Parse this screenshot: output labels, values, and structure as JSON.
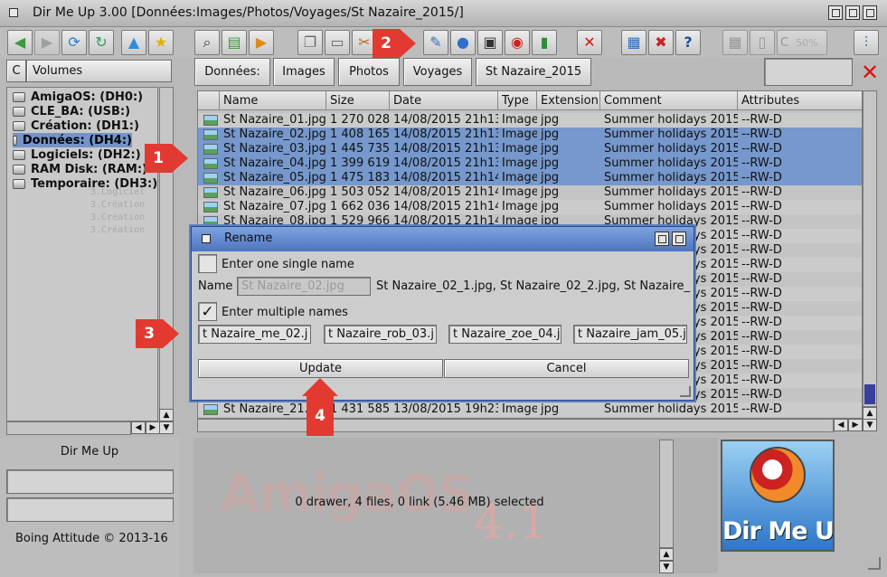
{
  "window": {
    "title": "Dir Me Up 3.00 [Données:Images/Photos/Voyages/St Nazaire_2015/]"
  },
  "icons": {
    "toolbar_left": [
      "back-arrow-icon",
      "forward-arrow-icon",
      "reload-icon",
      "refresh-icon",
      "new-drawer-icon",
      "favorite-star-icon"
    ],
    "toolbar_mid": [
      "search-icon",
      "size-icon",
      "play-icon",
      "copy-icon",
      "paste-icon",
      "cut-icon",
      "rename-icon",
      "comment-icon",
      "protect-lock-icon",
      "info-icon",
      "book-icon"
    ],
    "toolbar_right": [
      "delete-icon",
      "sort-icon",
      "kill-icon",
      "help-icon"
    ]
  },
  "toolbar": {
    "percent": "50%"
  },
  "left_panel": {
    "header": "Volumes",
    "volumes": [
      {
        "label": "AmigaOS: (DH0:)",
        "selected": false
      },
      {
        "label": "CLE_BA: (USB:)",
        "selected": false
      },
      {
        "label": "Création: (DH1:)",
        "selected": false
      },
      {
        "label": "Données: (DH4:)",
        "selected": true
      },
      {
        "label": "Logiciels: (DH2:)",
        "selected": false
      },
      {
        "label": "RAM Disk: (RAM:)",
        "selected": false
      },
      {
        "label": "Temporaire: (DH3:)",
        "selected": false
      }
    ],
    "app_name": "Dir Me Up",
    "copyright": "Boing Attitude © 2013-16"
  },
  "breadcrumb": [
    "Données:",
    "Images",
    "Photos",
    "Voyages",
    "St Nazaire_2015"
  ],
  "table": {
    "columns": [
      "Name",
      "Size",
      "Date",
      "Type",
      "Extension",
      "Comment",
      "Attributes"
    ],
    "rows": [
      {
        "name": "St Nazaire_01.jpg",
        "size": "1 270 028",
        "date": "14/08/2015 21h13",
        "type": "Image",
        "ext": "jpg",
        "comment": "Summer holidays 2015",
        "attr": "--RW-D",
        "selected": false
      },
      {
        "name": "St Nazaire_02.jpg",
        "size": "1 408 165",
        "date": "14/08/2015 21h13",
        "type": "Image",
        "ext": "jpg",
        "comment": "Summer holidays 2015",
        "attr": "--RW-D",
        "selected": true
      },
      {
        "name": "St Nazaire_03.jpg",
        "size": "1 445 735",
        "date": "14/08/2015 21h13",
        "type": "Image",
        "ext": "jpg",
        "comment": "Summer holidays 2015",
        "attr": "--RW-D",
        "selected": true
      },
      {
        "name": "St Nazaire_04.jpg",
        "size": "1 399 619",
        "date": "14/08/2015 21h13",
        "type": "Image",
        "ext": "jpg",
        "comment": "Summer holidays 2015",
        "attr": "--RW-D",
        "selected": true
      },
      {
        "name": "St Nazaire_05.jpg",
        "size": "1 475 183",
        "date": "14/08/2015 21h14",
        "type": "Image",
        "ext": "jpg",
        "comment": "Summer holidays 2015",
        "attr": "--RW-D",
        "selected": true
      },
      {
        "name": "St Nazaire_06.jpg",
        "size": "1 503 052",
        "date": "14/08/2015 21h14",
        "type": "Image",
        "ext": "jpg",
        "comment": "Summer holidays 2015",
        "attr": "--RW-D",
        "selected": false
      },
      {
        "name": "St Nazaire_07.jpg",
        "size": "1 662 036",
        "date": "14/08/2015 21h14",
        "type": "Image",
        "ext": "jpg",
        "comment": "Summer holidays 2015",
        "attr": "--RW-D",
        "selected": false
      },
      {
        "name": "St Nazaire_08.jpg",
        "size": "1 529 966",
        "date": "14/08/2015 21h14",
        "type": "Image",
        "ext": "jpg",
        "comment": "Summer holidays 2015",
        "attr": "--RW-D",
        "selected": false
      },
      {
        "name": "",
        "size": "",
        "date": "",
        "type": "",
        "ext": "",
        "comment": "Summer holidays 2015",
        "attr": "--RW-D",
        "selected": false
      },
      {
        "name": "",
        "size": "",
        "date": "",
        "type": "",
        "ext": "",
        "comment": "Summer holidays 2015",
        "attr": "--RW-D",
        "selected": false
      },
      {
        "name": "",
        "size": "",
        "date": "",
        "type": "",
        "ext": "",
        "comment": "Summer holidays 2015",
        "attr": "--RW-D",
        "selected": false
      },
      {
        "name": "",
        "size": "",
        "date": "",
        "type": "",
        "ext": "",
        "comment": "Summer holidays 2015",
        "attr": "--RW-D",
        "selected": false
      },
      {
        "name": "",
        "size": "",
        "date": "",
        "type": "",
        "ext": "",
        "comment": "Summer holidays 2015",
        "attr": "--RW-D",
        "selected": false
      },
      {
        "name": "",
        "size": "",
        "date": "",
        "type": "",
        "ext": "",
        "comment": "Summer holidays 2015",
        "attr": "--RW-D",
        "selected": false
      },
      {
        "name": "",
        "size": "",
        "date": "",
        "type": "",
        "ext": "",
        "comment": "Summer holidays 2015",
        "attr": "--RW-D",
        "selected": false
      },
      {
        "name": "",
        "size": "",
        "date": "",
        "type": "",
        "ext": "",
        "comment": "Summer holidays 2015",
        "attr": "--RW-D",
        "selected": false
      },
      {
        "name": "",
        "size": "",
        "date": "",
        "type": "",
        "ext": "",
        "comment": "Summer holidays 2015",
        "attr": "--RW-D",
        "selected": false
      },
      {
        "name": "",
        "size": "",
        "date": "",
        "type": "",
        "ext": "",
        "comment": "Summer holidays 2015",
        "attr": "--RW-D",
        "selected": false
      },
      {
        "name": "",
        "size": "",
        "date": "",
        "type": "",
        "ext": "",
        "comment": "Summer holidays 2015",
        "attr": "--RW-D",
        "selected": false
      },
      {
        "name": "",
        "size": "",
        "date": "",
        "type": "",
        "ext": "",
        "comment": "Summer holidays 2015",
        "attr": "--RW-D",
        "selected": false
      },
      {
        "name": "St Nazaire_21.jpg",
        "size": "1 431 585",
        "date": "13/08/2015 19h23",
        "type": "Image",
        "ext": "jpg",
        "comment": "Summer holidays 2015",
        "attr": "--RW-D",
        "selected": false
      }
    ]
  },
  "dialog": {
    "title": "Rename",
    "single_label": "Enter one single name",
    "name_label": "Name",
    "name_placeholder": "St Nazaire_02.jpg",
    "preview": "St Nazaire_02_1.jpg, St Nazaire_02_2.jpg, St Nazaire_",
    "multiple_label": "Enter multiple names",
    "multiple_checked": true,
    "check_mark": "✓",
    "fields": [
      "t Nazaire_me_02.j",
      "t Nazaire_rob_03.j",
      "t Nazaire_zoe_04.j",
      "t Nazaire_jam_05.j"
    ],
    "update_label": "Update",
    "cancel_label": "Cancel"
  },
  "status": {
    "text": "0 drawer, 4 files, 0 link (5.46 MB) selected"
  },
  "logo": {
    "text": "Dir Me Up"
  },
  "callouts": [
    "1",
    "2",
    "3",
    "4"
  ],
  "colors": {
    "selection": "#7698cc",
    "dialog_title": "#5b7fc1",
    "callout": "#e23a31",
    "delete": "#d11"
  }
}
